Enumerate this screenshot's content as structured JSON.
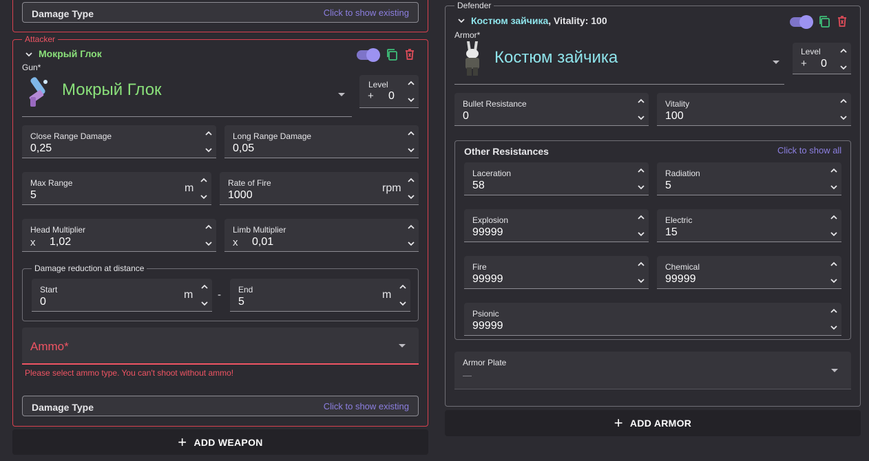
{
  "top_damage_type": {
    "title": "Damage Type",
    "link": "Click to show existing"
  },
  "attacker": {
    "legend": "Attacker",
    "weapon_name": "Мокрый Глок",
    "gun_label": "Gun*",
    "gun_name": "Мокрый Глок",
    "level": {
      "label": "Level",
      "prefix": "+",
      "value": "0"
    },
    "close_range": {
      "label": "Close Range Damage",
      "value": "0,25"
    },
    "long_range": {
      "label": "Long Range Damage",
      "value": "0,05"
    },
    "max_range": {
      "label": "Max Range",
      "value": "5",
      "unit": "m"
    },
    "rate_of_fire": {
      "label": "Rate of Fire",
      "value": "1000",
      "unit": "rpm"
    },
    "head_mult": {
      "label": "Head Multiplier",
      "prefix": "x",
      "value": "1,02"
    },
    "limb_mult": {
      "label": "Limb Multiplier",
      "prefix": "x",
      "value": "0,01"
    },
    "reduction": {
      "legend": "Damage reduction at distance",
      "start": {
        "label": "Start",
        "value": "0",
        "unit": "m"
      },
      "separator": "-",
      "end": {
        "label": "End",
        "value": "5",
        "unit": "m"
      }
    },
    "ammo": {
      "label": "Ammo*",
      "error": "Please select ammo type. You can't shoot without ammo!"
    },
    "damage_type": {
      "title": "Damage Type",
      "link": "Click to show existing"
    }
  },
  "add_weapon": "ADD WEAPON",
  "defender": {
    "legend": "Defender",
    "armor_title": "Костюм зайчика",
    "armor_vitality": ", Vitality: 100",
    "armor_label": "Armor*",
    "armor_name": "Костюм зайчика",
    "level": {
      "label": "Level",
      "prefix": "+",
      "value": "0"
    },
    "bullet_res": {
      "label": "Bullet Resistance",
      "value": "0"
    },
    "vitality": {
      "label": "Vitality",
      "value": "100"
    },
    "other": {
      "title": "Other Resistances",
      "link": "Click to show all",
      "laceration": {
        "label": "Laceration",
        "value": "58"
      },
      "radiation": {
        "label": "Radiation",
        "value": "5"
      },
      "explosion": {
        "label": "Explosion",
        "value": "99999"
      },
      "electric": {
        "label": "Electric",
        "value": "15"
      },
      "fire": {
        "label": "Fire",
        "value": "99999"
      },
      "chemical": {
        "label": "Chemical",
        "value": "99999"
      },
      "psionic": {
        "label": "Psionic",
        "value": "99999"
      }
    },
    "armor_plate": {
      "label": "Armor Plate",
      "value": "—"
    }
  },
  "add_armor": "ADD ARMOR",
  "colors": {
    "accent_green": "#8ae07a",
    "accent_cyan": "#8ee3ea",
    "error_red": "#ef5463",
    "link_purple": "#8c7fe0",
    "toggle": "#9c92f1",
    "copy_green": "#3ec07a",
    "delete_red": "#e34d5a"
  }
}
